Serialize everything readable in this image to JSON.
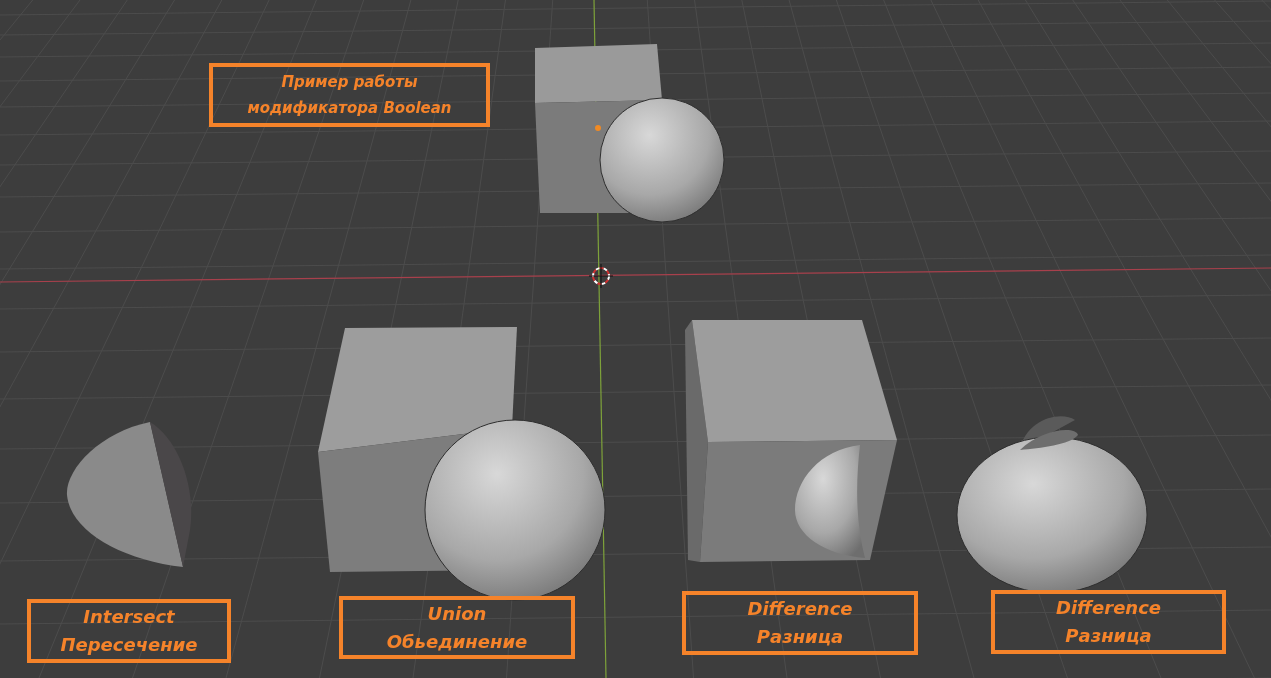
{
  "annotations": [
    {
      "kind": "title",
      "lines": [
        "Пример работы",
        "модификатора Boolean"
      ]
    },
    {
      "kind": "caption",
      "lines": [
        "Intersect",
        "Пересечение"
      ]
    },
    {
      "kind": "caption",
      "lines": [
        "Union",
        "Обьединение"
      ]
    },
    {
      "kind": "caption",
      "lines": [
        "Difference",
        "Разница"
      ]
    },
    {
      "kind": "caption",
      "lines": [
        "Difference",
        "Разница"
      ]
    }
  ]
}
